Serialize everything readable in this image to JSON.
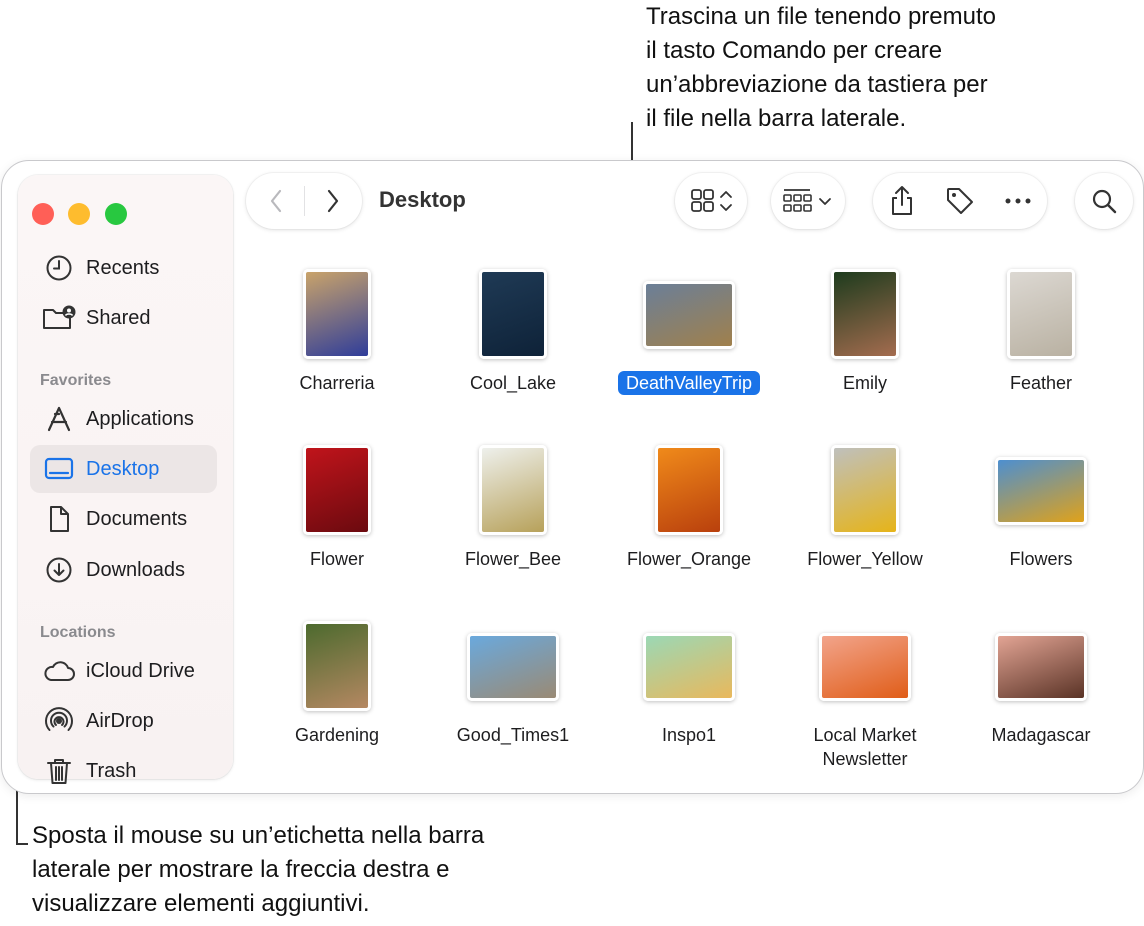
{
  "callouts": {
    "top": "Trascina un file tenendo premuto\nil tasto Comando per creare\nun’abbreviazione da tastiera per\nil file nella barra laterale.",
    "bottom": "Sposta il mouse su un’etichetta nella barra\nlaterale per mostrare la freccia destra e\nvisualizzare elementi aggiuntivi."
  },
  "window": {
    "title": "Desktop"
  },
  "sidebar": {
    "top_items": [
      {
        "label": "Recents",
        "icon": "clock-icon"
      },
      {
        "label": "Shared",
        "icon": "shared-folder-icon"
      }
    ],
    "favorites_header": "Favorites",
    "favorites": [
      {
        "label": "Applications",
        "icon": "applications-icon"
      },
      {
        "label": "Desktop",
        "icon": "desktop-icon",
        "active": true
      },
      {
        "label": "Documents",
        "icon": "document-icon"
      },
      {
        "label": "Downloads",
        "icon": "download-icon"
      }
    ],
    "locations_header": "Locations",
    "locations": [
      {
        "label": "iCloud Drive",
        "icon": "cloud-icon"
      },
      {
        "label": "AirDrop",
        "icon": "airdrop-icon"
      },
      {
        "label": "Trash",
        "icon": "trash-icon"
      }
    ]
  },
  "files": [
    {
      "name": "Charreria",
      "thumb": "portrait",
      "colors": [
        "#c9a36a",
        "#2f3d9a"
      ]
    },
    {
      "name": "Cool_Lake",
      "thumb": "portrait",
      "colors": [
        "#1f3a55",
        "#0e2238"
      ]
    },
    {
      "name": "DeathValleyTrip",
      "thumb": "landscape",
      "colors": [
        "#6b7f98",
        "#a0804c"
      ],
      "selected": true
    },
    {
      "name": "Emily",
      "thumb": "portrait",
      "colors": [
        "#1d3b1d",
        "#a46c4f"
      ]
    },
    {
      "name": "Feather",
      "thumb": "portrait",
      "colors": [
        "#dcd8d2",
        "#b9b1a2"
      ]
    },
    {
      "name": "Flower",
      "thumb": "portrait",
      "colors": [
        "#c0141b",
        "#6b0a0f"
      ]
    },
    {
      "name": "Flower_Bee",
      "thumb": "portrait",
      "colors": [
        "#eef0ec",
        "#b7a15a"
      ]
    },
    {
      "name": "Flower_Orange",
      "thumb": "portrait",
      "colors": [
        "#f08a1a",
        "#b9400d"
      ]
    },
    {
      "name": "Flower_Yellow",
      "thumb": "portrait",
      "colors": [
        "#bfc0bd",
        "#e6b418"
      ]
    },
    {
      "name": "Flowers",
      "thumb": "landscape",
      "colors": [
        "#4d8fd0",
        "#e0a21a"
      ]
    },
    {
      "name": "Gardening",
      "thumb": "portrait",
      "colors": [
        "#4c6a2e",
        "#b58862"
      ]
    },
    {
      "name": "Good_Times1",
      "thumb": "landscape",
      "colors": [
        "#6aa9dd",
        "#9a8a74"
      ]
    },
    {
      "name": "Inspo1",
      "thumb": "landscape",
      "colors": [
        "#9bd8b5",
        "#e9b85c"
      ]
    },
    {
      "name": "Local Market\nNewsletter",
      "thumb": "landscape",
      "colors": [
        "#f2a48b",
        "#e05d18"
      ]
    },
    {
      "name": "Madagascar",
      "thumb": "landscape",
      "colors": [
        "#e2a494",
        "#5a3326"
      ]
    }
  ]
}
